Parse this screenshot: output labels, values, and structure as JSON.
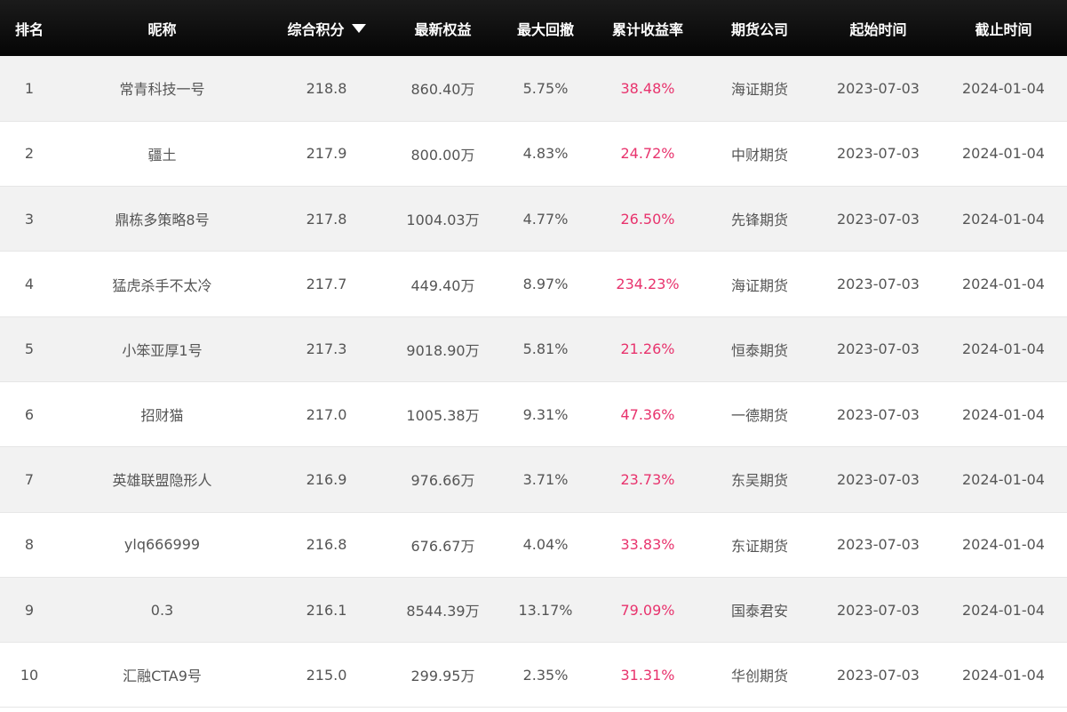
{
  "colors": {
    "header_bg": "#111111",
    "header_text": "#ffffff",
    "row_alt_bg": "#f2f2f2",
    "row_bg": "#ffffff",
    "text": "#555555",
    "return_accent": "#e8336d"
  },
  "icons": {
    "sort": "caret-down-icon"
  },
  "table": {
    "columns": [
      "排名",
      "昵称",
      "综合积分",
      "最新权益",
      "最大回撤",
      "累计收益率",
      "期货公司",
      "起始时间",
      "截止时间"
    ],
    "sorted_column": "综合积分",
    "rows": [
      {
        "rank": "1",
        "nickname": "常青科技一号",
        "score": "218.8",
        "equity": "860.40万",
        "drawdown": "5.75%",
        "return": "38.48%",
        "company": "海证期货",
        "start": "2023-07-03",
        "end": "2024-01-04"
      },
      {
        "rank": "2",
        "nickname": "疆土",
        "score": "217.9",
        "equity": "800.00万",
        "drawdown": "4.83%",
        "return": "24.72%",
        "company": "中财期货",
        "start": "2023-07-03",
        "end": "2024-01-04"
      },
      {
        "rank": "3",
        "nickname": "鼎栋多策略8号",
        "score": "217.8",
        "equity": "1004.03万",
        "drawdown": "4.77%",
        "return": "26.50%",
        "company": "先锋期货",
        "start": "2023-07-03",
        "end": "2024-01-04"
      },
      {
        "rank": "4",
        "nickname": "猛虎杀手不太冷",
        "score": "217.7",
        "equity": "449.40万",
        "drawdown": "8.97%",
        "return": "234.23%",
        "company": "海证期货",
        "start": "2023-07-03",
        "end": "2024-01-04"
      },
      {
        "rank": "5",
        "nickname": "小笨亚厚1号",
        "score": "217.3",
        "equity": "9018.90万",
        "drawdown": "5.81%",
        "return": "21.26%",
        "company": "恒泰期货",
        "start": "2023-07-03",
        "end": "2024-01-04"
      },
      {
        "rank": "6",
        "nickname": "招财猫",
        "score": "217.0",
        "equity": "1005.38万",
        "drawdown": "9.31%",
        "return": "47.36%",
        "company": "一德期货",
        "start": "2023-07-03",
        "end": "2024-01-04"
      },
      {
        "rank": "7",
        "nickname": "英雄联盟隐形人",
        "score": "216.9",
        "equity": "976.66万",
        "drawdown": "3.71%",
        "return": "23.73%",
        "company": "东吴期货",
        "start": "2023-07-03",
        "end": "2024-01-04"
      },
      {
        "rank": "8",
        "nickname": "ylq666999",
        "score": "216.8",
        "equity": "676.67万",
        "drawdown": "4.04%",
        "return": "33.83%",
        "company": "东证期货",
        "start": "2023-07-03",
        "end": "2024-01-04"
      },
      {
        "rank": "9",
        "nickname": "0.3",
        "score": "216.1",
        "equity": "8544.39万",
        "drawdown": "13.17%",
        "return": "79.09%",
        "company": "国泰君安",
        "start": "2023-07-03",
        "end": "2024-01-04"
      },
      {
        "rank": "10",
        "nickname": "汇融CTA9号",
        "score": "215.0",
        "equity": "299.95万",
        "drawdown": "2.35%",
        "return": "31.31%",
        "company": "华创期货",
        "start": "2023-07-03",
        "end": "2024-01-04"
      }
    ]
  }
}
